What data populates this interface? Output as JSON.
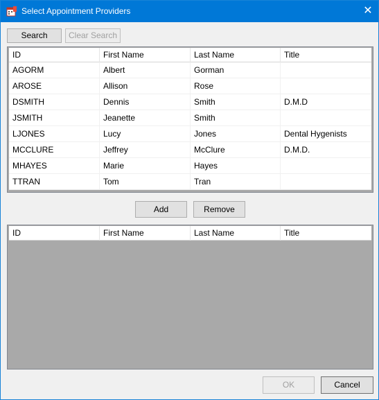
{
  "window": {
    "title": "Select Appointment Providers"
  },
  "toolbar": {
    "search_label": "Search",
    "clear_search_label": "Clear Search"
  },
  "columns": [
    "ID",
    "First Name",
    "Last Name",
    "Title"
  ],
  "providers": [
    [
      "AGORM",
      "Albert",
      "Gorman",
      ""
    ],
    [
      "AROSE",
      "Allison",
      "Rose",
      ""
    ],
    [
      "DSMITH",
      "Dennis",
      "Smith",
      "D.M.D"
    ],
    [
      "JSMITH",
      "Jeanette",
      "Smith",
      ""
    ],
    [
      "LJONES",
      "Lucy",
      "Jones",
      "Dental Hygenists"
    ],
    [
      "MCCLURE",
      "Jeffrey",
      "McClure",
      "D.M.D."
    ],
    [
      "MHAYES",
      "Marie",
      "Hayes",
      ""
    ],
    [
      "TTRAN",
      "Tom",
      "Tran",
      ""
    ]
  ],
  "actions": {
    "add_label": "Add",
    "remove_label": "Remove"
  },
  "selected_columns": [
    "ID",
    "First Name",
    "Last Name",
    "Title"
  ],
  "footer": {
    "ok_label": "OK",
    "cancel_label": "Cancel"
  },
  "icons": {
    "app": "calendar-icon",
    "close": "close-icon"
  },
  "colors": {
    "titlebar": "#0078d7",
    "empty_grid": "#a9a9a9"
  }
}
